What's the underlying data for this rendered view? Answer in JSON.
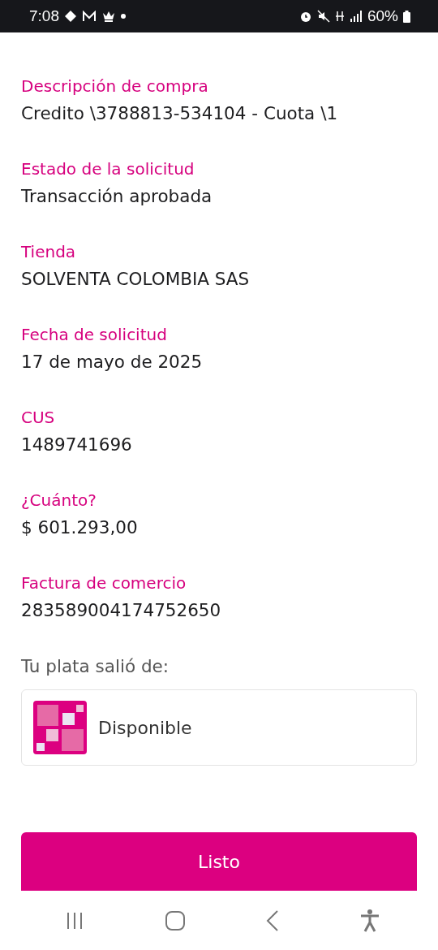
{
  "status_bar": {
    "time": "7:08",
    "battery": "60%"
  },
  "fields": [
    {
      "label": "Descripción de compra",
      "value": "Credito \\3788813-534104 - Cuota \\1"
    },
    {
      "label": "Estado de la solicitud",
      "value": "Transacción aprobada"
    },
    {
      "label": "Tienda",
      "value": "SOLVENTA COLOMBIA SAS"
    },
    {
      "label": "Fecha de solicitud",
      "value": "17 de mayo de 2025"
    },
    {
      "label": "CUS",
      "value": "1489741696"
    },
    {
      "label": "¿Cuánto?",
      "value": "$ 601.293,00"
    },
    {
      "label": "Factura de comercio",
      "value": "283589004174752650"
    }
  ],
  "source": {
    "heading": "Tu plata salió de:",
    "account": "Disponible"
  },
  "done_button": "Listo"
}
